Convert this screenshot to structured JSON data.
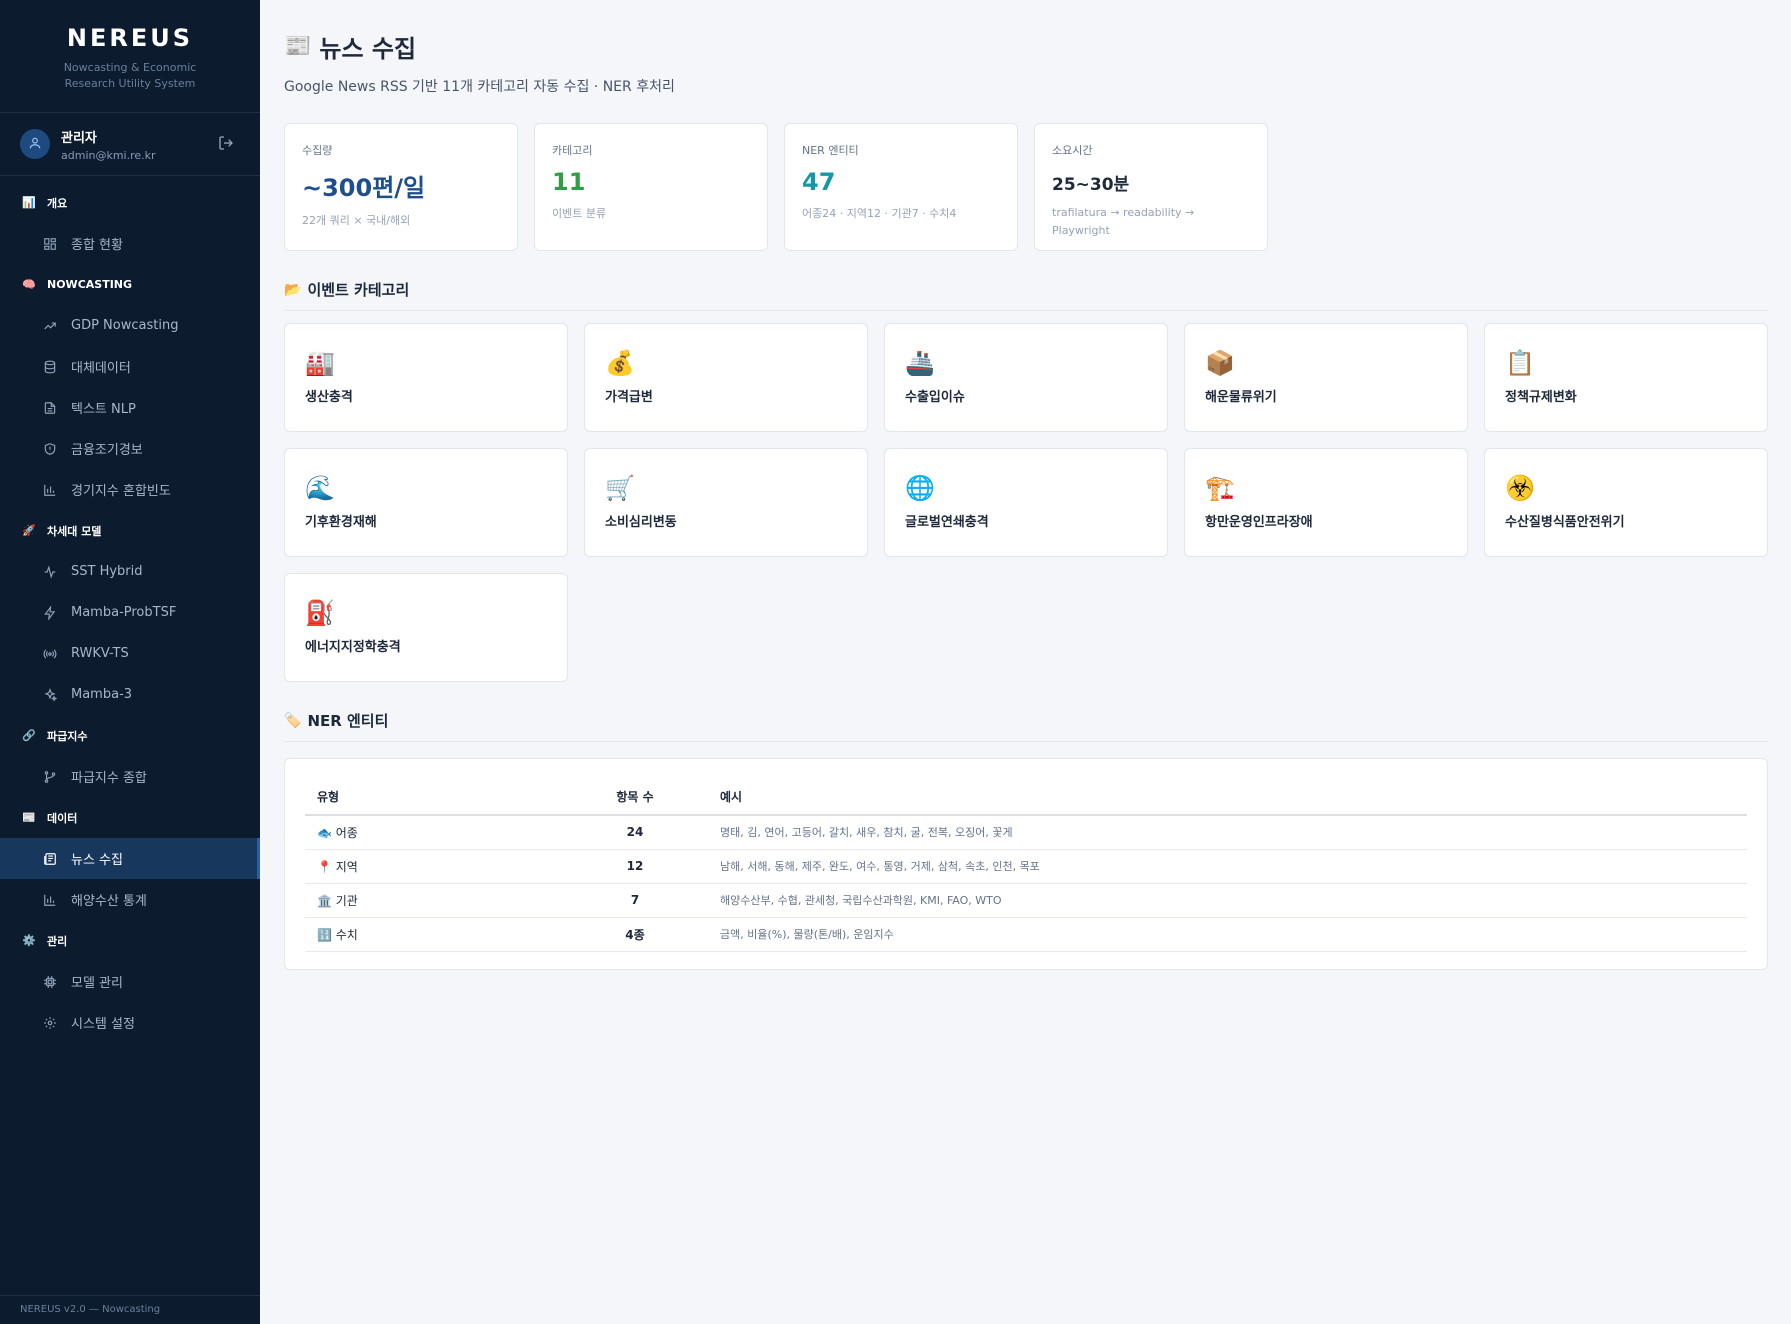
{
  "sidebar": {
    "brand": "NEREUS",
    "brand_sub_1": "Nowcasting & Economic",
    "brand_sub_2": "Research Utility System",
    "user": {
      "name": "관리자",
      "email": "admin@kmi.re.kr"
    },
    "sections": [
      {
        "title": "개요",
        "icon": "📊",
        "items": [
          {
            "label": "종합 현황",
            "icon": "grid-icon"
          }
        ]
      },
      {
        "title": "NOWCASTING",
        "icon": "🧠",
        "items": [
          {
            "label": "GDP Nowcasting",
            "icon": "trend-icon"
          },
          {
            "label": "대체데이터",
            "icon": "database-icon"
          },
          {
            "label": "텍스트 NLP",
            "icon": "document-icon"
          },
          {
            "label": "금융조기경보",
            "icon": "shield-icon"
          },
          {
            "label": "경기지수 혼합빈도",
            "icon": "bar-chart-icon"
          }
        ]
      },
      {
        "title": "차세대 모델",
        "icon": "🚀",
        "items": [
          {
            "label": "SST Hybrid",
            "icon": "pulse-icon"
          },
          {
            "label": "Mamba-ProbTSF",
            "icon": "bolt-icon"
          },
          {
            "label": "RWKV-TS",
            "icon": "radio-icon"
          },
          {
            "label": "Mamba-3",
            "icon": "sparkle-icon"
          }
        ]
      },
      {
        "title": "파급지수",
        "icon": "🔗",
        "items": [
          {
            "label": "파급지수 종합",
            "icon": "branch-icon"
          }
        ]
      },
      {
        "title": "데이터",
        "icon": "📰",
        "items": [
          {
            "label": "뉴스 수집",
            "icon": "newspaper-icon",
            "active": true
          },
          {
            "label": "해양수산 통계",
            "icon": "bar-chart-icon"
          }
        ]
      },
      {
        "title": "관리",
        "icon": "⚙️",
        "items": [
          {
            "label": "모델 관리",
            "icon": "chip-icon"
          },
          {
            "label": "시스템 설정",
            "icon": "gear-icon"
          }
        ]
      }
    ],
    "footer": "NEREUS v2.0 — Nowcasting"
  },
  "header": {
    "emoji": "📰",
    "title": "뉴스 수집",
    "subtitle": "Google News RSS 기반 11개 카테고리 자동 수집 · NER 후처리"
  },
  "stats": [
    {
      "label": "수집량",
      "value": "~300편/일",
      "desc": "22개 쿼리 × 국내/해외",
      "color": "#1e4e8c"
    },
    {
      "label": "카테고리",
      "value": "11",
      "desc": "이벤트 분류",
      "color": "#2f9e44"
    },
    {
      "label": "NER 엔티티",
      "value": "47",
      "desc": "어종24 · 지역12 · 기관7 · 수치4",
      "color": "#1597a8"
    },
    {
      "label": "소요시간",
      "value": "25~30분",
      "desc": "trafilatura → readability → Playwright",
      "color": "#1e293b"
    }
  ],
  "categories_section": {
    "emoji": "📂",
    "title": "이벤트 카테고리"
  },
  "categories": [
    {
      "icon": "🏭",
      "label": "생산충격"
    },
    {
      "icon": "💰",
      "label": "가격급변"
    },
    {
      "icon": "🚢",
      "label": "수출입이슈"
    },
    {
      "icon": "📦",
      "label": "해운물류위기"
    },
    {
      "icon": "📋",
      "label": "정책규제변화"
    },
    {
      "icon": "🌊",
      "label": "기후환경재해"
    },
    {
      "icon": "🛒",
      "label": "소비심리변동"
    },
    {
      "icon": "🌐",
      "label": "글로벌연쇄충격"
    },
    {
      "icon": "🏗️",
      "label": "항만운영인프라장애"
    },
    {
      "icon": "☣️",
      "label": "수산질병식품안전위기"
    },
    {
      "icon": "⛽",
      "label": "에너지지정학충격"
    }
  ],
  "ner_section": {
    "emoji": "🏷️",
    "title": "NER 엔티티"
  },
  "ner_table": {
    "headers": [
      "유형",
      "항목 수",
      "예시"
    ],
    "rows": [
      {
        "type": "🐟 어종",
        "count": "24",
        "examples": "명태, 김, 연어, 고등어, 갈치, 새우, 참치, 굴, 전복, 오징어, 꽃게"
      },
      {
        "type": "📍 지역",
        "count": "12",
        "examples": "남해, 서해, 동해, 제주, 완도, 여수, 통영, 거제, 삼척, 속초, 인천, 목포"
      },
      {
        "type": "🏛️ 기관",
        "count": "7",
        "examples": "해양수산부, 수협, 관세청, 국립수산과학원, KMI, FAO, WTO"
      },
      {
        "type": "🔢 수치",
        "count": "4종",
        "examples": "금액, 비율(%), 물량(톤/배), 운임지수"
      }
    ]
  }
}
